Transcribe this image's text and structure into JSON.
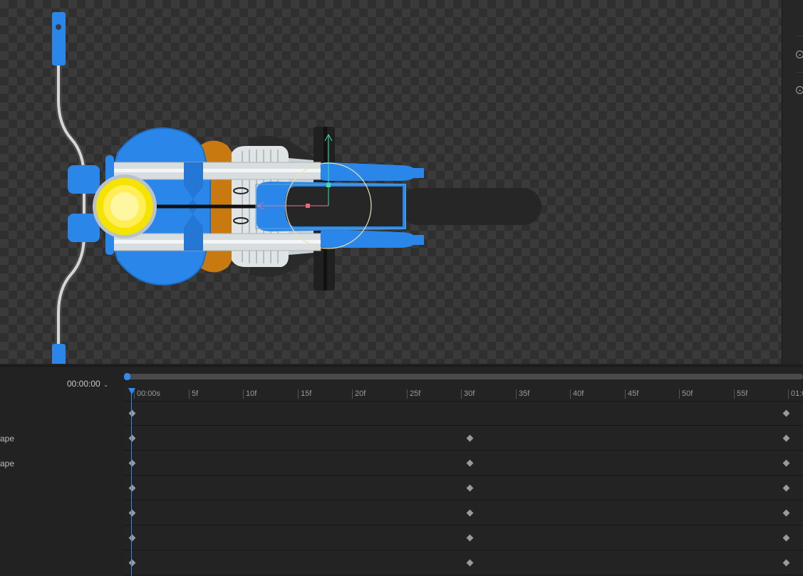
{
  "timeline": {
    "current_time": "00:00:00",
    "ruler_labels": [
      "00:00s",
      "5f",
      "10f",
      "15f",
      "20f",
      "25f",
      "30f",
      "35f",
      "40f",
      "45f",
      "50f",
      "55f",
      "01:0"
    ],
    "layers": [
      {
        "label": ""
      },
      {
        "label": "ape"
      },
      {
        "label": "ape"
      },
      {
        "label": ""
      },
      {
        "label": ""
      },
      {
        "label": ""
      },
      {
        "label": ""
      }
    ],
    "keyframes_frames": [
      [
        0,
        60
      ],
      [
        0,
        31,
        60
      ],
      [
        0,
        31,
        60
      ],
      [
        0,
        31,
        60
      ],
      [
        0,
        31,
        60
      ],
      [
        0,
        31,
        60
      ],
      [
        0,
        31,
        60
      ]
    ],
    "accent_color": "#2c8cf0"
  },
  "canvas": {
    "subject": "motorcycle-top-view",
    "colors": {
      "body": "#2a86e8",
      "headlight": "#f5e400",
      "tank": "#c87a10",
      "chrome": "#d8dde0",
      "seat": "#262626"
    }
  }
}
